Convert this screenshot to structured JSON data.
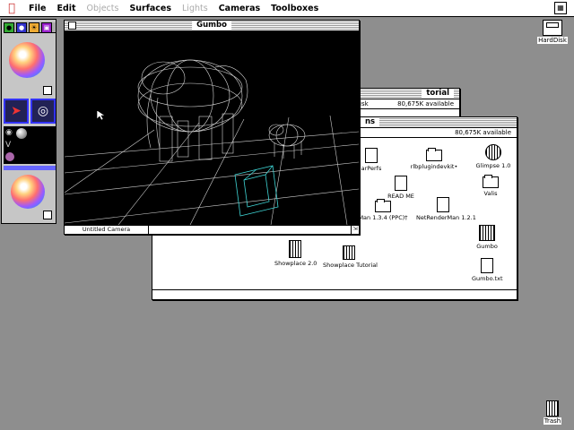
{
  "menubar": {
    "items": [
      {
        "label": "File",
        "enabled": true
      },
      {
        "label": "Edit",
        "enabled": true
      },
      {
        "label": "Objects",
        "enabled": false
      },
      {
        "label": "Surfaces",
        "enabled": true
      },
      {
        "label": "Lights",
        "enabled": false
      },
      {
        "label": "Cameras",
        "enabled": true
      },
      {
        "label": "Toolboxes",
        "enabled": true
      }
    ]
  },
  "desktop": {
    "harddisk_label": "HardDisk",
    "trash_label": "Trash"
  },
  "back_window": {
    "title": "torial",
    "info": "isk",
    "available": "80,675K available"
  },
  "finder_window": {
    "title": "ns",
    "available": "80,675K available",
    "items": [
      {
        "label": "arPerfs",
        "kind": "doc"
      },
      {
        "label": "rlbplugindevkit•",
        "kind": "folder"
      },
      {
        "label": "Glimpse 1.0",
        "kind": "app"
      },
      {
        "label": "READ ME",
        "kind": "doc"
      },
      {
        "label": "Valis",
        "kind": "folder"
      },
      {
        "label": "Man 1.3.4 (PPC)†",
        "kind": "folder"
      },
      {
        "label": "NetRenderMan 1.2.1",
        "kind": "doc"
      },
      {
        "label": "Gumbo",
        "kind": "app"
      },
      {
        "label": "Gumbo.txt",
        "kind": "doc"
      },
      {
        "label": "Showplace 2.0",
        "kind": "app"
      },
      {
        "label": "Showplace Tutorial",
        "kind": "app"
      }
    ]
  },
  "gumbo_window": {
    "title": "Gumbo",
    "camera_name": "Untitled Camera"
  },
  "colors": {
    "desktop": "#8e8e8e",
    "viewport": "#000000",
    "wireframe": "#dddddd",
    "selection": "#3fd6d6"
  }
}
